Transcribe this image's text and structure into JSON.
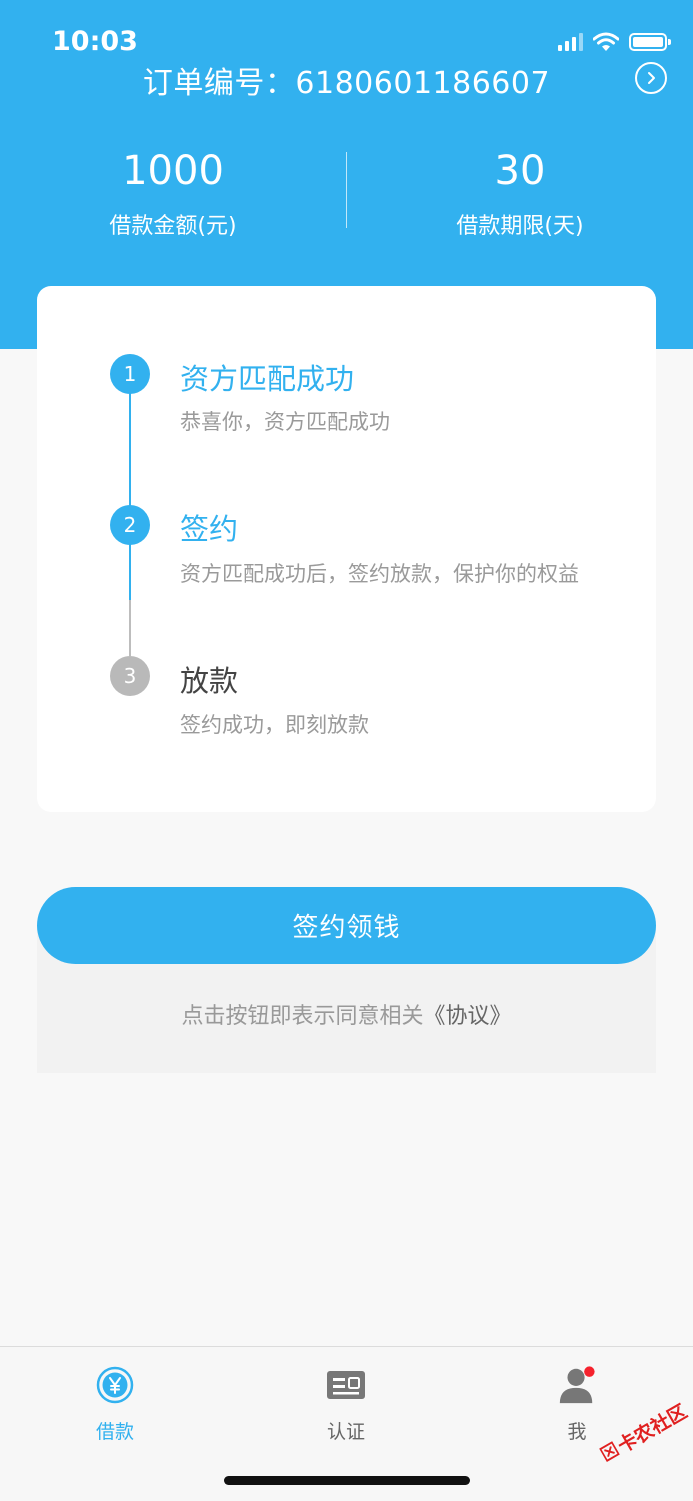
{
  "status_bar": {
    "time": "10:03"
  },
  "header": {
    "order_label": "订单编号：6180601186607",
    "stats": [
      {
        "value": "1000",
        "label": "借款金额(元)"
      },
      {
        "value": "30",
        "label": "借款期限(天)"
      }
    ]
  },
  "steps": [
    {
      "num": "1",
      "title": "资方匹配成功",
      "desc": "恭喜你，资方匹配成功",
      "state": "active"
    },
    {
      "num": "2",
      "title": "签约",
      "desc": "资方匹配成功后，签约放款，保护你的权益",
      "state": "active"
    },
    {
      "num": "3",
      "title": "放款",
      "desc": "签约成功，即刻放款",
      "state": "inactive"
    }
  ],
  "cta": {
    "label": "签约领钱"
  },
  "agreement": {
    "text": "点击按钮即表示同意相关",
    "link": "《协议》"
  },
  "tabs": [
    {
      "label": "借款",
      "icon": "yen-circle-icon",
      "active": true
    },
    {
      "label": "认证",
      "icon": "id-card-icon",
      "active": false
    },
    {
      "label": "我",
      "icon": "user-icon",
      "active": false,
      "badge": true
    }
  ],
  "watermark": {
    "text": "卡农社区"
  },
  "colors": {
    "primary": "#32b1ef",
    "inactive": "#b9b9b9",
    "badge": "#f5222d"
  }
}
